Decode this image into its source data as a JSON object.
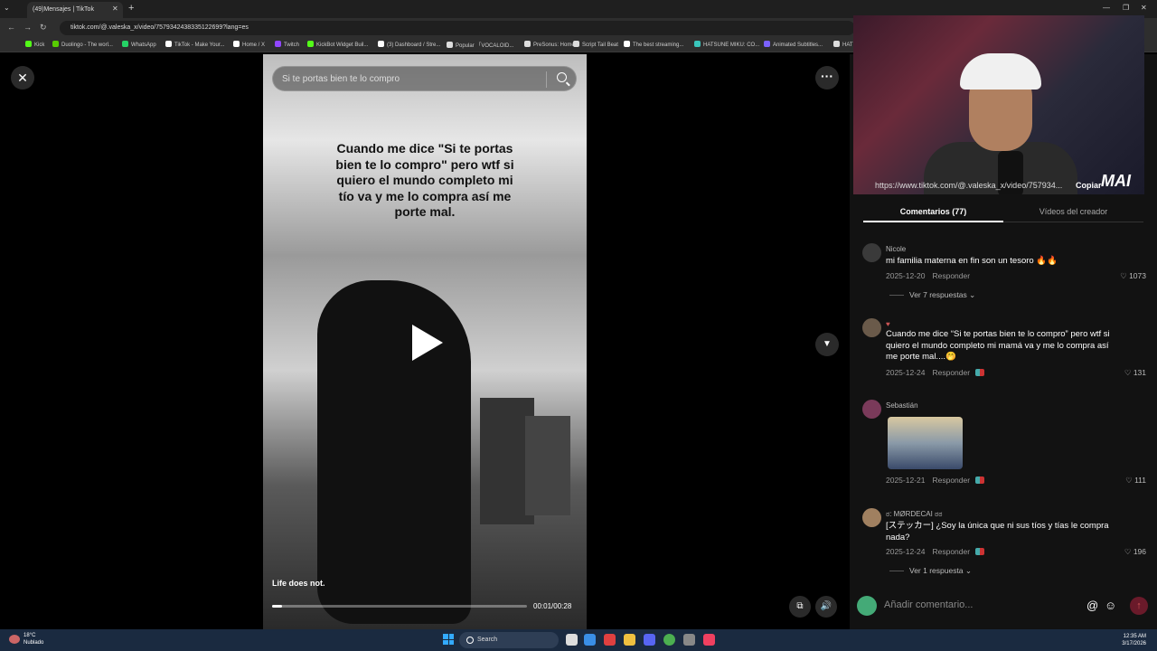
{
  "browser": {
    "tab_title": "(49)Mensajes | TikTok",
    "url": "tiktok.com/@.valeska_x/video/7579342438335122699?lang=es",
    "bookmarks": [
      {
        "label": "Kick",
        "color": "#53fc18"
      },
      {
        "label": "Duolingo - The worl...",
        "color": "#58cc02"
      },
      {
        "label": "WhatsApp",
        "color": "#25d366"
      },
      {
        "label": "TikTok - Make Your...",
        "color": "#ffffff"
      },
      {
        "label": "Home / X",
        "color": "#ffffff"
      },
      {
        "label": "Twitch",
        "color": "#9146ff"
      },
      {
        "label": "KickBot Widget Buil...",
        "color": "#53fc18"
      },
      {
        "label": "(3) Dashboard / Stre...",
        "color": "#ffffff"
      },
      {
        "label": "Popular 「VOCALOID...",
        "color": "#dddddd"
      },
      {
        "label": "PreSonus: Home",
        "color": "#dddddd"
      },
      {
        "label": "Script Tail Beat",
        "color": "#dddddd"
      },
      {
        "label": "The best streaming...",
        "color": "#ffffff"
      },
      {
        "label": "HATSUNE MIKU: CO...",
        "color": "#39c5bb"
      },
      {
        "label": "Animated Subtitles...",
        "color": "#7b61ff"
      },
      {
        "label": "HAT",
        "color": "#dddddd"
      }
    ]
  },
  "video": {
    "search_placeholder": "Si te portas bien te lo compro",
    "overlay_text": "Cuando me dice \"Si te portas bien te lo compro\" pero wtf si quiero el mundo completo mi tío va y me lo compra así me porte mal.",
    "caption": "Life does not.",
    "timecode": "00:01/00:28",
    "progress": 0.04
  },
  "webcam": {
    "url_text": "https://www.tiktok.com/@.valeska_x/video/757934...",
    "copy_label": "Copiar",
    "logo": "MAI"
  },
  "panel": {
    "tab_comments": "Comentarios (77)",
    "tab_creator": "Vídeos del creador",
    "comments": [
      {
        "user": "Nicole",
        "text": "mi familia materna en fin son un tesoro 🔥🔥",
        "date": "2025-12-20",
        "reply": "Responder",
        "likes": "1073",
        "replies": "Ver 7 respuestas ⌄"
      },
      {
        "user": "♥",
        "text": "Cuando me dice “Si te portas bien te lo compro” pero wtf si quiero el mundo completo mi mamá va y me lo compra así me porte mal....🤭",
        "date": "2025-12-24",
        "reply": "Responder",
        "likes": "131",
        "replies": ""
      },
      {
        "user": "Sebastián",
        "text": "",
        "date": "2025-12-21",
        "reply": "Responder",
        "likes": "111",
        "replies": ""
      },
      {
        "user": "ಠ: MØRDECAI ಠಠ",
        "text": "[ステッカー] ¿Soy la única que ni sus tíos y tías le compra nada?",
        "date": "2025-12-24",
        "reply": "Responder",
        "likes": "196",
        "replies": "Ver 1 respuesta ⌄"
      }
    ],
    "input_placeholder": "Añadir comentario..."
  },
  "taskbar": {
    "temp": "18°C",
    "weather": "Nublado",
    "search_label": "Search",
    "time": "12:35 AM",
    "date": "3/17/2026"
  }
}
